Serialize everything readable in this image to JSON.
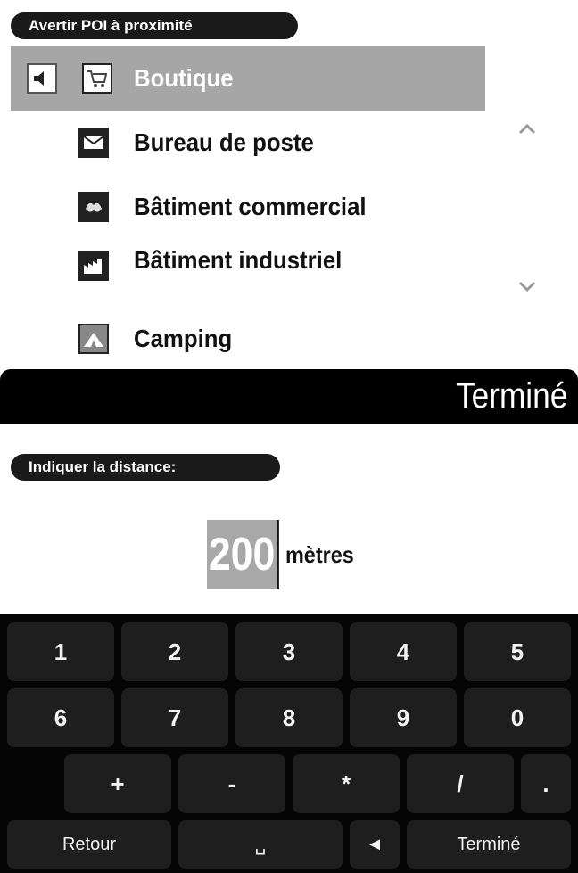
{
  "poi_section": {
    "title": "Avertir POI à proximité",
    "items": [
      {
        "label": "Boutique",
        "icon": "shopping-cart-icon",
        "selected": true
      },
      {
        "label": "Bureau de poste",
        "icon": "envelope-icon",
        "selected": false
      },
      {
        "label": "Bâtiment commercial",
        "icon": "commercial-building-icon",
        "selected": false
      },
      {
        "label": "Bâtiment industriel",
        "icon": "factory-icon",
        "selected": false
      },
      {
        "label": "Camping",
        "icon": "tent-icon",
        "selected": false
      }
    ],
    "done_label": "Terminé"
  },
  "distance_section": {
    "title": "Indiquer la distance:",
    "value": "200",
    "unit": "mètres"
  },
  "keyboard": {
    "row1": [
      "1",
      "2",
      "3",
      "4",
      "5"
    ],
    "row2": [
      "6",
      "7",
      "8",
      "9",
      "0"
    ],
    "row3": [
      "+",
      "-",
      "*",
      "/",
      "."
    ],
    "back_label": "Retour",
    "space_glyph": "␣",
    "backspace_glyph": "◄",
    "done_label": "Terminé"
  },
  "colors": {
    "selected_row": "#a6a6a6",
    "keyboard_bg": "#050505",
    "key_bg": "#1e1e1e",
    "pill_bg": "#1a1a1a"
  }
}
